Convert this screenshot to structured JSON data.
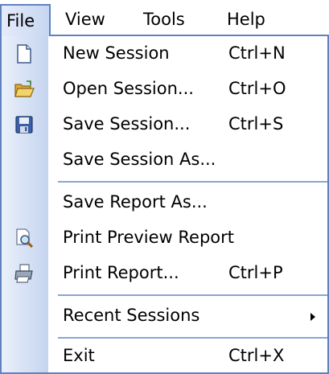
{
  "menubar": {
    "items": [
      {
        "label": "File"
      },
      {
        "label": "View"
      },
      {
        "label": "Tools"
      },
      {
        "label": "Help"
      }
    ]
  },
  "file_menu": {
    "items": [
      {
        "label": "New Session",
        "shortcut": "Ctrl+N",
        "icon": "new-document-icon"
      },
      {
        "label": "Open Session...",
        "shortcut": "Ctrl+O",
        "icon": "open-folder-icon"
      },
      {
        "label": "Save Session...",
        "shortcut": "Ctrl+S",
        "icon": "save-disk-icon"
      },
      {
        "label": "Save Session As...",
        "shortcut": ""
      },
      {
        "label": "Save Report As...",
        "shortcut": ""
      },
      {
        "label": "Print Preview Report",
        "shortcut": "",
        "icon": "print-preview-icon"
      },
      {
        "label": "Print Report...",
        "shortcut": "Ctrl+P",
        "icon": "printer-icon"
      },
      {
        "label": "Recent Sessions",
        "shortcut": "",
        "submenu": true
      },
      {
        "label": "Exit",
        "shortcut": "Ctrl+X"
      }
    ]
  },
  "colors": {
    "accent_border": "#5f82c1",
    "icon_column_light": "#eaf0fb",
    "icon_column_dark": "#c5d4ef",
    "separator": "#8aa4d4"
  }
}
